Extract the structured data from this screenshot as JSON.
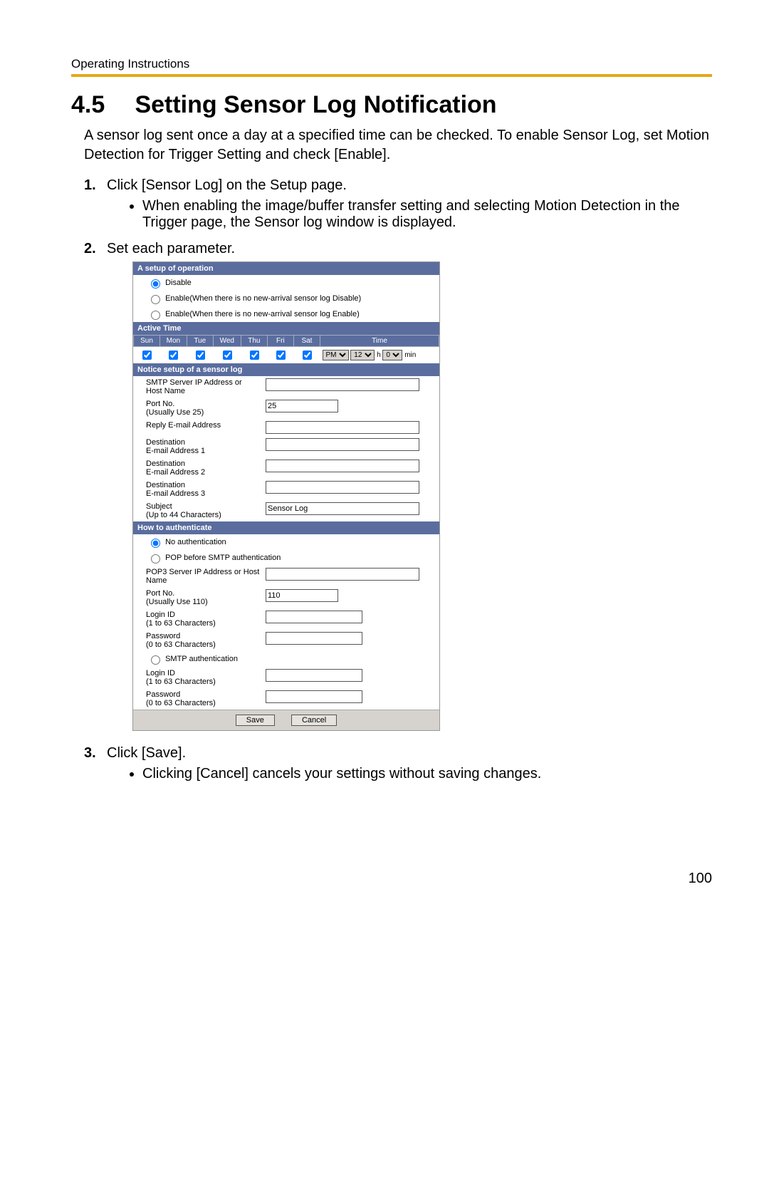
{
  "header": "Operating Instructions",
  "section_num": "4.5",
  "section_title": "Setting Sensor Log Notification",
  "intro": "A sensor log sent once a day at a specified time can be checked. To enable Sensor Log, set Motion Detection for Trigger Setting and check [Enable].",
  "steps": [
    {
      "num": "1.",
      "text": "Click [Sensor Log] on the Setup page.",
      "bullets": [
        "When enabling the image/buffer transfer setting and selecting Motion Detection in the Trigger page, the Sensor log window is displayed."
      ]
    },
    {
      "num": "2.",
      "text": "Set each parameter."
    },
    {
      "num": "3.",
      "text": "Click [Save].",
      "bullets": [
        "Clicking [Cancel] cancels your settings without saving changes."
      ]
    }
  ],
  "panel": {
    "setup_hdr": "A setup of operation",
    "op_disable": "Disable",
    "op_enable_disable": "Enable(When there is no new-arrival sensor log Disable)",
    "op_enable_enable": "Enable(When there is no new-arrival sensor log Enable)",
    "active_hdr": "Active Time",
    "days": [
      "Sun",
      "Mon",
      "Tue",
      "Wed",
      "Thu",
      "Fri",
      "Sat"
    ],
    "time_hdr": "Time",
    "ampm": "PM",
    "hour": "12",
    "h_lbl": "h",
    "min": "0",
    "min_lbl": "min",
    "notice_hdr": "Notice setup of a sensor log",
    "smtp_lbl": "SMTP Server IP Address or Host Name",
    "port_lbl": "Port No.",
    "port_sub": "(Usually Use 25)",
    "port_val": "25",
    "reply_lbl": "Reply E-mail Address",
    "dest_lbl": "Destination",
    "dest1": "E-mail Address 1",
    "dest2": "E-mail Address 2",
    "dest3": "E-mail Address 3",
    "subject_lbl": "Subject",
    "subject_sub": "(Up to 44 Characters)",
    "subject_val": "Sensor Log",
    "auth_hdr": "How to authenticate",
    "auth_none": "No authentication",
    "auth_pop": "POP before SMTP authentication",
    "pop3_lbl": "POP3 Server IP Address or Host Name",
    "pop3_port_lbl": "Port No.",
    "pop3_port_sub": "(Usually Use 110)",
    "pop3_port_val": "110",
    "login_lbl": "Login ID",
    "login_sub": "(1 to 63 Characters)",
    "pwd_lbl": "Password",
    "pwd_sub": "(0 to 63 Characters)",
    "auth_smtp": "SMTP authentication",
    "save_btn": "Save",
    "cancel_btn": "Cancel"
  },
  "page_num": "100"
}
